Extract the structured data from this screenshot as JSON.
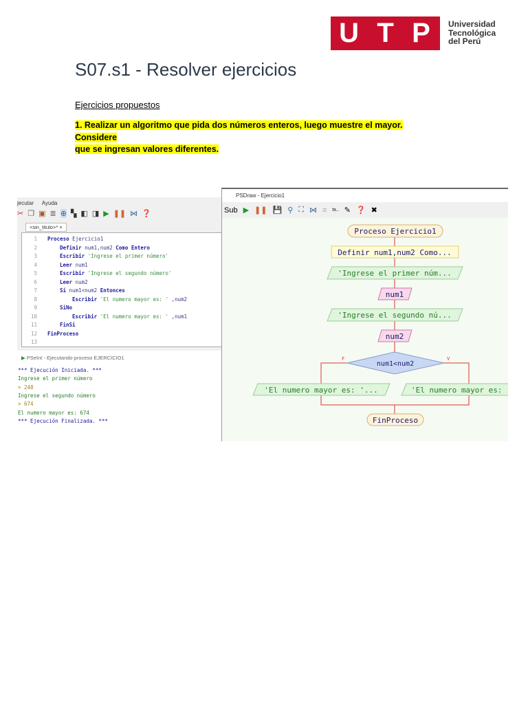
{
  "logo": {
    "letters": [
      "U",
      "T",
      "P"
    ],
    "lines": [
      "Universidad",
      "Tecnológica",
      "del Perú"
    ],
    "brand_color": "#c8102e"
  },
  "title": "S07.s1 - Resolver ejercicios",
  "subtitle": "Ejercicios propuestos",
  "exercise": [
    "1. Realizar un algoritmo que pida dos números enteros, luego muestre el mayor. Considere",
    "que se ingresan valores diferentes."
  ],
  "editor": {
    "menu": [
      "jecutar",
      "Ayuda"
    ],
    "tab": "<sin_titulo>*",
    "tab_close": "×",
    "lines": [
      {
        "n": "1",
        "indent": 0,
        "parts": [
          [
            "kw",
            "Proceso"
          ],
          [
            "",
            "Ejercicio1"
          ]
        ]
      },
      {
        "n": "2",
        "indent": 1,
        "parts": [
          [
            "kw",
            "Definir"
          ],
          [
            "",
            "num1,num2"
          ],
          [
            "kw",
            "Como Entero"
          ]
        ]
      },
      {
        "n": "3",
        "indent": 1,
        "parts": [
          [
            "kw",
            "Escribir"
          ],
          [
            "str",
            "'Ingrese el primer número'"
          ]
        ]
      },
      {
        "n": "4",
        "indent": 1,
        "parts": [
          [
            "kw",
            "Leer"
          ],
          [
            "",
            "num1"
          ]
        ]
      },
      {
        "n": "5",
        "indent": 1,
        "parts": [
          [
            "kw",
            "Escribir"
          ],
          [
            "str",
            "'Ingrese el segundo número'"
          ]
        ]
      },
      {
        "n": "6",
        "indent": 1,
        "parts": [
          [
            "kw",
            "Leer"
          ],
          [
            "",
            "num2"
          ]
        ]
      },
      {
        "n": "7",
        "indent": 1,
        "parts": [
          [
            "kw",
            "Si"
          ],
          [
            "",
            "num1<num2"
          ],
          [
            "kw",
            "Entonces"
          ]
        ]
      },
      {
        "n": "8",
        "indent": 2,
        "parts": [
          [
            "kw",
            "Escribir"
          ],
          [
            "str",
            "'El numero mayor es: '"
          ],
          [
            "",
            ",num2"
          ]
        ]
      },
      {
        "n": "9",
        "indent": 1,
        "parts": [
          [
            "kw",
            "SiNo"
          ]
        ]
      },
      {
        "n": "10",
        "indent": 2,
        "parts": [
          [
            "kw",
            "Escribir"
          ],
          [
            "str",
            "'El numero mayor es: '"
          ],
          [
            "",
            ",num1"
          ]
        ]
      },
      {
        "n": "11",
        "indent": 1,
        "parts": [
          [
            "kw",
            "FinSi"
          ]
        ]
      },
      {
        "n": "12",
        "indent": 0,
        "parts": [
          [
            "kw",
            "FinProceso"
          ]
        ]
      },
      {
        "n": "13",
        "indent": 0,
        "parts": []
      }
    ]
  },
  "console": {
    "title": "PSeInt - Ejecutando proceso EJERCICIO1",
    "lines": [
      {
        "text": "*** Ejecución Iniciada. ***",
        "color": "#1a1a9a"
      },
      {
        "text": "Ingrese el primer número",
        "color": "#2a7a2a"
      },
      {
        "text": "> 248",
        "color": "#a08020"
      },
      {
        "text": "Ingrese el segundo número",
        "color": "#2a7a2a"
      },
      {
        "text": "> 674",
        "color": "#a08020"
      },
      {
        "text": "El numero mayor es: 674",
        "color": "#2a7a2a"
      },
      {
        "text": "*** Ejecución Finalizada. ***",
        "color": "#1a1a9a"
      }
    ]
  },
  "psdraw": {
    "title": "PSDraw - Ejercicio1",
    "toolbar_sub": "Sub",
    "flow": {
      "start": "Proceso Ejercicio1",
      "define": "Definir num1,num2 Como...",
      "out1": "'Ingrese el primer núm...",
      "in1": "num1",
      "out2": "'Ingrese el segundo nú...",
      "in2": "num2",
      "cond": "num1<num2",
      "false_label": "F",
      "true_label": "V",
      "out_false": "'El numero mayor es: '...",
      "out_true": "'El numero mayor es:",
      "end": "FinProceso"
    }
  }
}
